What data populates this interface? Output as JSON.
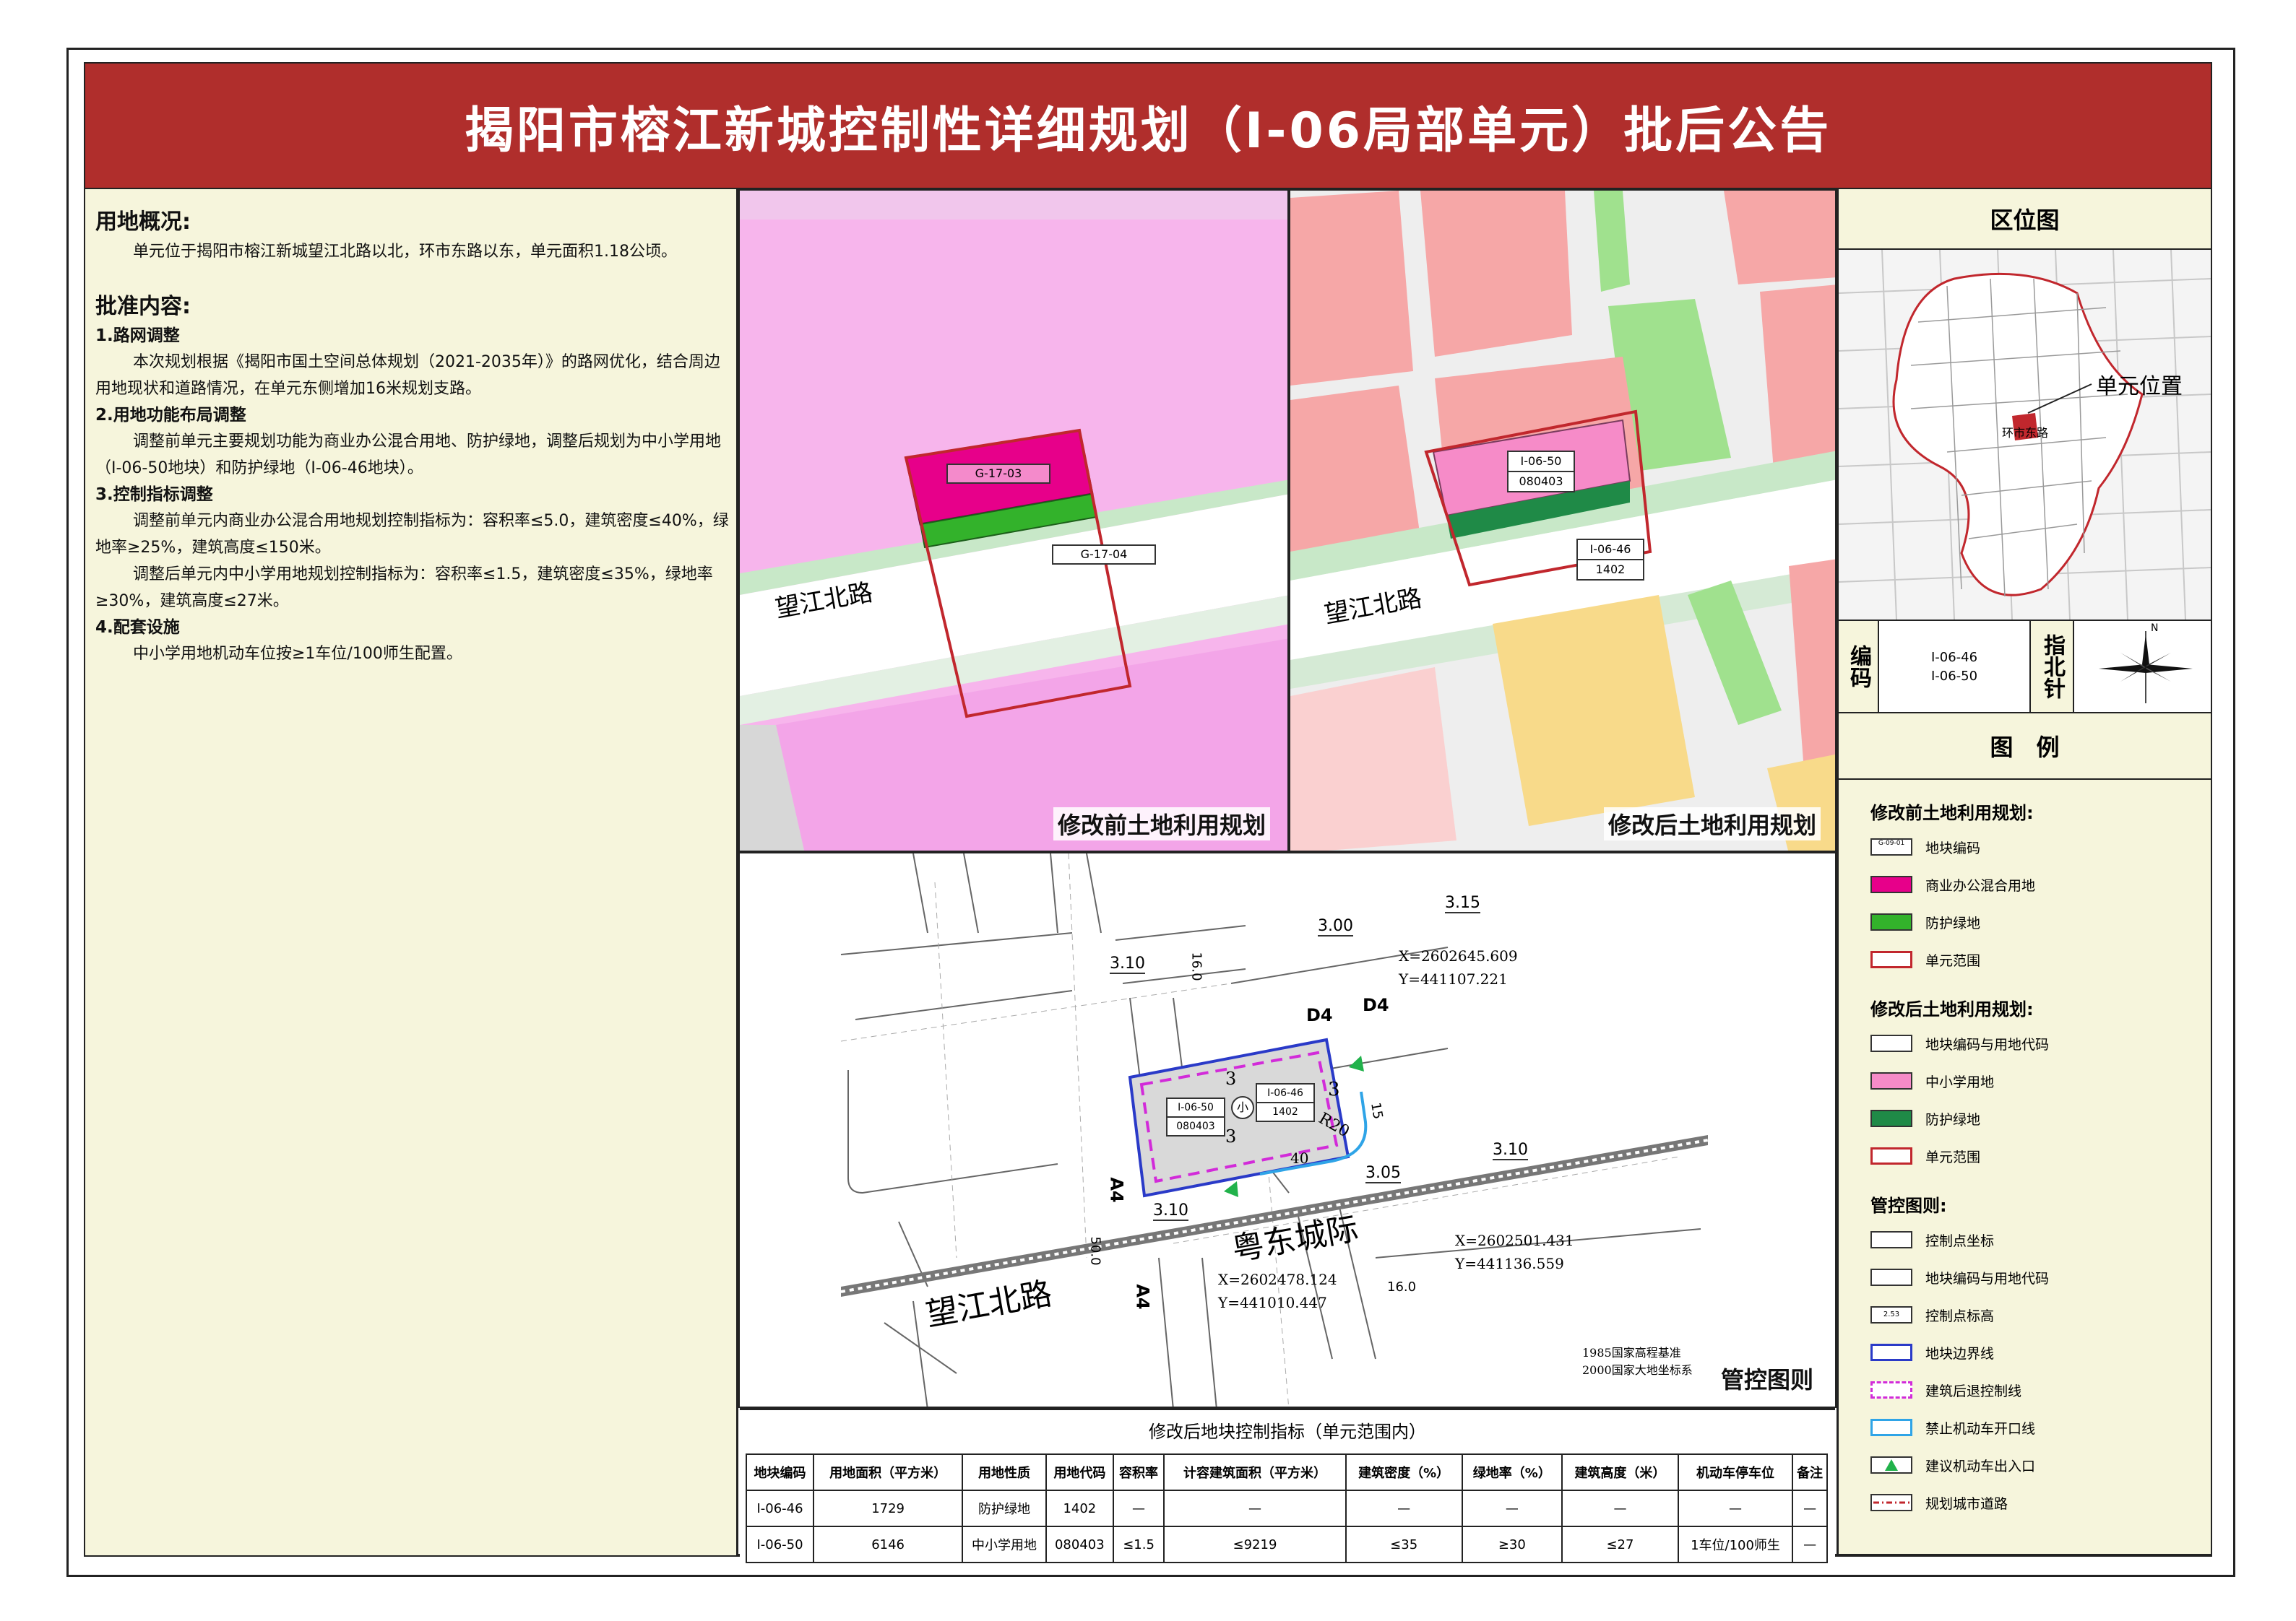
{
  "title": "揭阳市榕江新城控制性详细规划（I-06局部单元）批后公告",
  "overview": {
    "heading": "用地概况:",
    "text": "单元位于揭阳市榕江新城望江北路以北，环市东路以东，单元面积1.18公顷。"
  },
  "approval": {
    "heading": "批准内容:",
    "s1_title": "1.路网调整",
    "s1_text": "本次规划根据《揭阳市国土空间总体规划（2021-2035年）》的路网优化，结合周边用地现状和道路情况，在单元东侧增加16米规划支路。",
    "s2_title": "2.用地功能布局调整",
    "s2_text": "调整前单元主要规划功能为商业办公混合用地、防护绿地，调整后规划为中小学用地（I-06-50地块）和防护绿地（I-06-46地块）。",
    "s3_title": "3.控制指标调整",
    "s3_text1": "调整前单元内商业办公混合用地规划控制指标为：容积率≤5.0，建筑密度≤40%，绿地率≥25%，建筑高度≤150米。",
    "s3_text2": "调整后单元内中小学用地规划控制指标为：容积率≤1.5，建筑密度≤35%，绿地率≥30%，建筑高度≤27米。",
    "s4_title": "4.配套设施",
    "s4_text": "中小学用地机动车位按≥1车位/100师生配置。"
  },
  "map_before": {
    "label": "修改前土地利用规划",
    "road": "望江北路",
    "code1": "G-17-03",
    "code2": "G-17-04"
  },
  "map_after": {
    "label": "修改后土地利用规划",
    "road": "望江北路",
    "code1": "I-06-50",
    "use1": "080403",
    "code2": "I-06-46",
    "use2": "1402"
  },
  "map_control": {
    "label": "管控图则",
    "road1": "望江北路",
    "road2": "粤东城际",
    "d4a": "D4",
    "d4b": "D4",
    "a4a": "A4",
    "a4b": "A4",
    "h1": "3.10",
    "h2": "3.00",
    "h3": "3.15",
    "h4": "3.10",
    "h5": "3.05",
    "h6": "3.10",
    "w1": "16.0",
    "w2": "16.0",
    "w3": "50.0",
    "dim40": "40",
    "dim15": "15",
    "r20": "R20",
    "s3a": "3",
    "s3b": "3",
    "s3c": "3",
    "small": "小",
    "blk1_code": "I-06-50",
    "blk1_use": "080403",
    "blk2_code": "I-06-46",
    "blk2_use": "1402",
    "coord1_x": "X=2602645.609",
    "coord1_y": "Y=441107.221",
    "coord2_x": "X=2602501.431",
    "coord2_y": "Y=441136.559",
    "coord3_x": "X=2602478.124",
    "coord3_y": "Y=441010.447",
    "datum1": "1985国家高程基准",
    "datum2": "2000国家大地坐标系"
  },
  "location": {
    "heading": "区位图",
    "marker": "单元位置",
    "road_ring": "环市东路",
    "code_label": "编码",
    "codes": [
      "I-06-46",
      "I-06-50"
    ],
    "compass_label": "指北针",
    "north": "N"
  },
  "legend": {
    "heading": "图　例",
    "before_title": "修改前土地利用规划:",
    "before_items": [
      "地块编码",
      "商业办公混合用地",
      "防护绿地",
      "单元范围"
    ],
    "before_code_sample": "G-09-01",
    "after_title": "修改后土地利用规划:",
    "after_items": [
      "地块编码与用地代码",
      "中小学用地",
      "防护绿地",
      "单元范围"
    ],
    "control_title": "管控图则:",
    "control_items": [
      "控制点坐标",
      "地块编码与用地代码",
      "控制点标高",
      "地块边界线",
      "建筑后退控制线",
      "禁止机动车开口线",
      "建议机动车出入口",
      "规划城市道路"
    ],
    "elev_sample": "2.53"
  },
  "colors": {
    "title_bg": "#b02e2c",
    "panel_bg": "#f6f5dc",
    "commercial": "#e7008a",
    "green": "#33b22b",
    "school": "#f68bc8",
    "protect_green": "#1f8a47",
    "boundary_red": "#c1272d",
    "block_blue": "#2a3ac8",
    "setback_magenta": "#d22bd9"
  },
  "table": {
    "title": "修改后地块控制指标（单元范围内）",
    "headers": [
      "地块编码",
      "用地面积（平方米）",
      "用地性质",
      "用地代码",
      "容积率",
      "计容建筑面积（平方米）",
      "建筑密度（%）",
      "绿地率（%）",
      "建筑高度（米）",
      "机动车停车位",
      "备注"
    ],
    "rows": [
      [
        "I-06-46",
        "1729",
        "防护绿地",
        "1402",
        "—",
        "—",
        "—",
        "—",
        "—",
        "—",
        "—"
      ],
      [
        "I-06-50",
        "6146",
        "中小学用地",
        "080403",
        "≤1.5",
        "≤9219",
        "≤35",
        "≥30",
        "≤27",
        "1车位/100师生",
        "—"
      ]
    ]
  }
}
